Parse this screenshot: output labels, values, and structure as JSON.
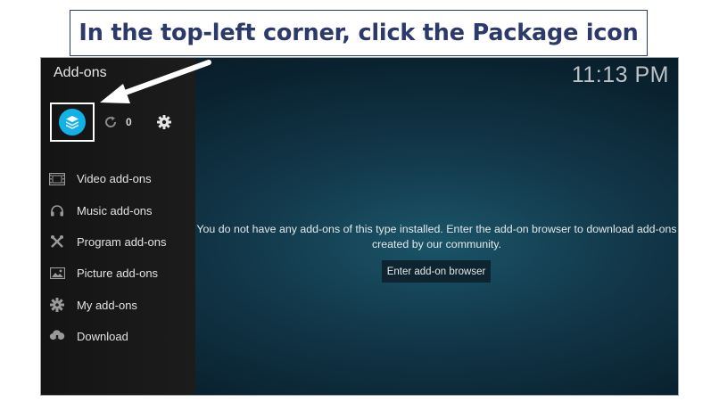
{
  "annotation": {
    "text": "In the top-left corner, click the Package icon",
    "color": "#2c3a6b"
  },
  "app": {
    "title": "Add-ons",
    "clock": "11:13 PM"
  },
  "toolbar": {
    "package_icon": "package-icon",
    "update_count": "0"
  },
  "sidebar": {
    "items": [
      {
        "label": "Video add-ons",
        "icon": "film-icon"
      },
      {
        "label": "Music add-ons",
        "icon": "headphones-icon"
      },
      {
        "label": "Program add-ons",
        "icon": "tools-icon"
      },
      {
        "label": "Picture add-ons",
        "icon": "picture-icon"
      },
      {
        "label": "My add-ons",
        "icon": "puzzle-icon"
      },
      {
        "label": "Download",
        "icon": "cloud-download-icon"
      }
    ]
  },
  "main": {
    "message": "You do not have any add-ons of this type installed. Enter the add-on browser to download add-ons created by our community.",
    "browse_button": "Enter add-on browser"
  },
  "colors": {
    "accent": "#12b2e7",
    "sidebar_bg": "#1a1a1a",
    "main_bg": "#12384a"
  }
}
